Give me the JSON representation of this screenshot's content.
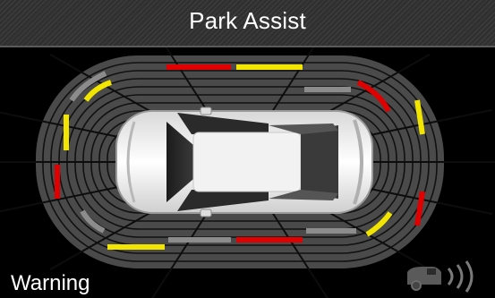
{
  "header": {
    "title": "Park Assist"
  },
  "status": {
    "text": "Warning",
    "level": "warning"
  },
  "zone_colors": {
    "grey": "#8c8c8c",
    "yellow": "#f2e600",
    "red": "#e00000"
  },
  "zones": {
    "front": [
      "red",
      "yellow",
      "grey"
    ],
    "front_corners": [
      "grey",
      "red"
    ],
    "front_sides": [
      "yellow",
      "yellow"
    ],
    "rear_sides": [
      "red",
      "red"
    ],
    "rear_corners": [
      "grey",
      "yellow"
    ],
    "rear": [
      "yellow",
      "grey",
      "red",
      "grey"
    ]
  },
  "icons": {
    "vehicle": "car-top-view-icon",
    "sensor": "parking-sensor-icon"
  }
}
